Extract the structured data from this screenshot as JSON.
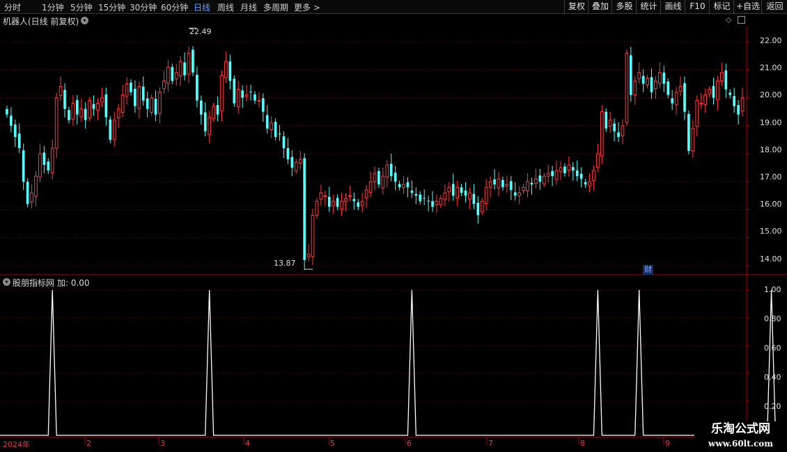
{
  "toolbar": {
    "periods": [
      "分时",
      "1分钟",
      "5分钟",
      "15分钟",
      "30分钟",
      "60分钟",
      "日线",
      "周线",
      "月线",
      "多周期",
      "更多"
    ],
    "active_period": "日线",
    "more_arrow": ">",
    "buttons": [
      "复权",
      "叠加",
      "多股",
      "统计",
      "画线",
      "F10",
      "标记",
      "+自选",
      "返回"
    ]
  },
  "main_panel": {
    "title": "机器人(日线 前复权)",
    "high_label": "22.49",
    "low_label": "13.87",
    "cai_badge": "财",
    "y_ticks": [
      "22.00",
      "21.00",
      "20.00",
      "19.00",
      "18.00",
      "17.00",
      "16.00",
      "15.00",
      "14.00"
    ]
  },
  "indicator_panel": {
    "title": "股朋指标网",
    "value_label": "加: 0.00",
    "y_ticks": [
      "1.00",
      "0.80",
      "0.60",
      "0.40",
      "0.20"
    ]
  },
  "x_axis": {
    "labels": [
      "2024年",
      "2",
      "3",
      "4",
      "5",
      "6",
      "7",
      "8",
      "9"
    ]
  },
  "watermark": {
    "line1": "乐淘公式网",
    "line2": "www.60lt.com"
  },
  "colors": {
    "up": "#ff3c3c",
    "down": "#53ffff",
    "grid": "#5a0000",
    "axis_line": "#b00000",
    "indicator": "#ffffff",
    "active_tab": "#5aa0ff"
  },
  "chart_data": [
    {
      "type": "candlestick",
      "title": "机器人(日线 前复权)",
      "ylim": [
        13.7,
        22.6
      ],
      "annotations": {
        "max": 22.49,
        "min": 13.87
      },
      "closes": [
        19.4,
        19.0,
        18.6,
        18.2,
        17.0,
        16.2,
        16.6,
        17.2,
        18.0,
        17.6,
        17.4,
        18.2,
        20.0,
        20.4,
        19.6,
        19.2,
        19.8,
        19.4,
        19.6,
        19.2,
        19.9,
        19.6,
        19.8,
        20.0,
        19.3,
        18.5,
        19.2,
        19.6,
        20.1,
        20.5,
        20.2,
        19.7,
        20.4,
        19.9,
        19.6,
        20.0,
        19.4,
        20.2,
        20.6,
        21.1,
        20.6,
        20.9,
        21.3,
        20.8,
        21.6,
        20.9,
        19.9,
        19.4,
        18.8,
        19.3,
        19.7,
        19.4,
        20.8,
        21.3,
        20.6,
        19.8,
        20.3,
        20.0,
        20.1,
        20.2,
        19.9,
        19.9,
        19.5,
        18.9,
        19.1,
        18.6,
        18.7,
        18.2,
        17.8,
        17.5,
        17.7,
        17.8,
        14.2,
        14.4,
        15.8,
        16.3,
        16.6,
        16.5,
        16.1,
        16.3,
        16.1,
        16.3,
        16.4,
        16.5,
        16.3,
        16.1,
        16.3,
        16.7,
        17.0,
        17.3,
        16.9,
        17.2,
        17.6,
        17.2,
        17.0,
        16.8,
        16.9,
        16.8,
        16.6,
        16.5,
        16.3,
        16.4,
        16.3,
        16.1,
        16.3,
        16.4,
        16.6,
        16.8,
        16.5,
        16.8,
        16.6,
        16.5,
        16.6,
        16.2,
        15.8,
        16.3,
        16.8,
        17.0,
        16.9,
        17.1,
        16.8,
        16.9,
        16.7,
        16.5,
        16.6,
        16.8,
        17.0,
        16.9,
        17.1,
        17.0,
        17.2,
        17.3,
        17.2,
        17.4,
        17.5,
        17.3,
        17.6,
        17.4,
        17.2,
        17.1,
        16.9,
        17.0,
        17.4,
        18.0,
        19.5,
        18.9,
        19.2,
        18.8,
        18.6,
        19.0,
        21.6,
        20.1,
        20.6,
        20.9,
        20.5,
        20.7,
        20.2,
        20.6,
        20.9,
        20.5,
        20.1,
        19.8,
        20.2,
        20.4,
        19.5,
        18.1,
        18.9,
        19.9,
        19.8,
        20.1,
        20.3,
        20.0,
        20.6,
        20.9,
        20.3,
        20.1,
        19.7,
        19.4,
        20.0
      ],
      "indicator": {
        "name": "股朋指标网",
        "signal_value": 1.0,
        "signal_bar_indices": [
          11,
          49,
          98,
          143,
          153,
          185
        ],
        "ylim": [
          0,
          1.0
        ]
      }
    }
  ]
}
